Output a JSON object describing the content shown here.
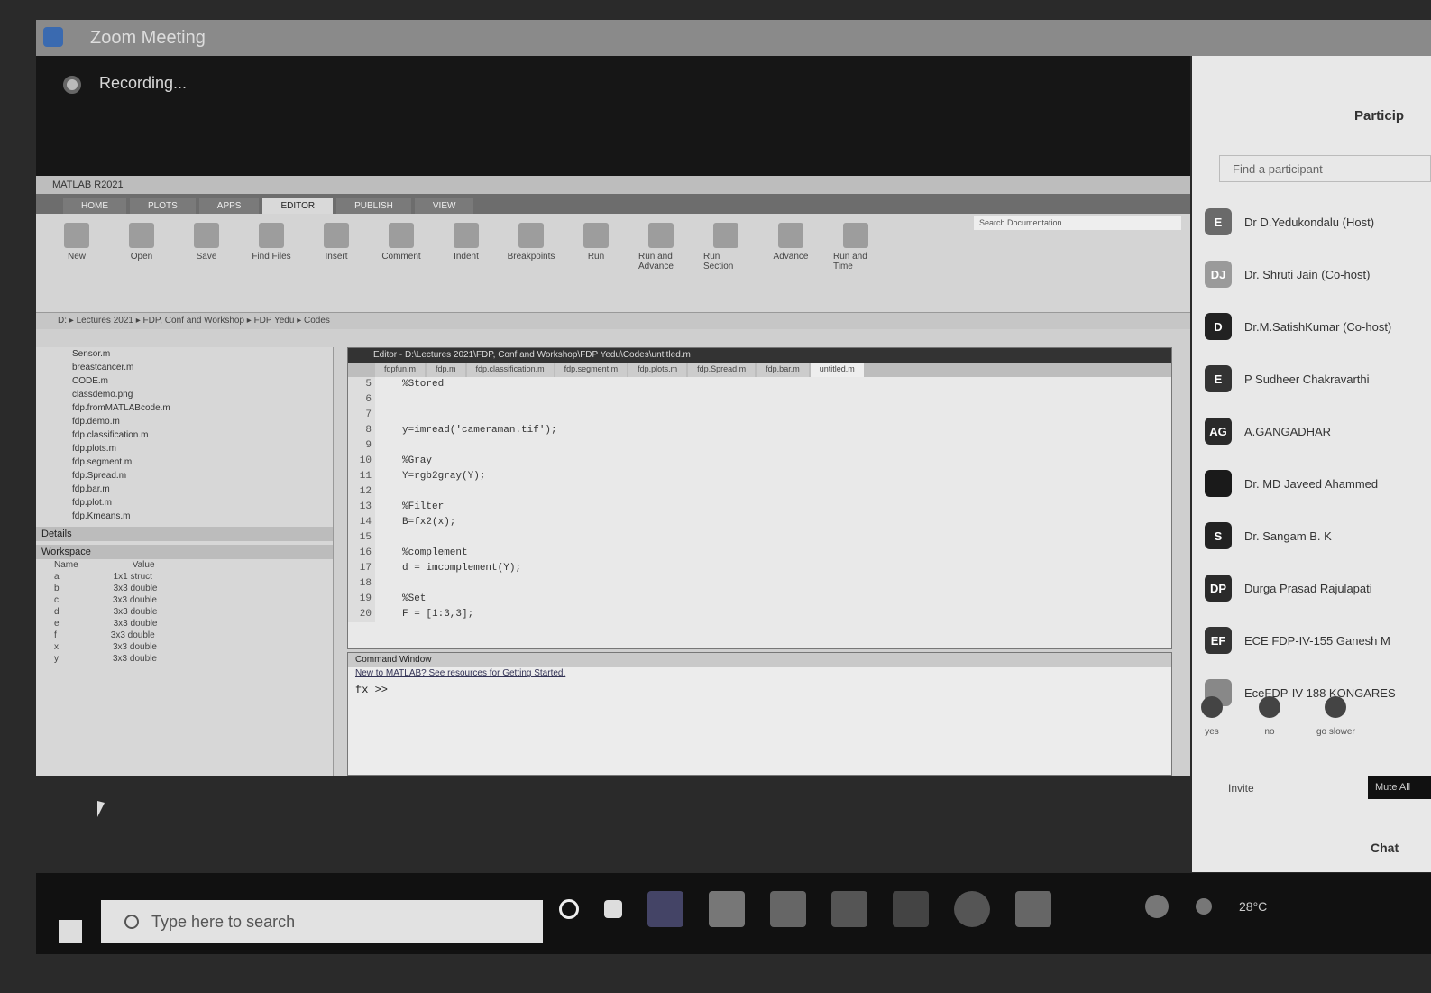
{
  "zoom": {
    "window_title": "Zoom Meeting",
    "recording_label": "Recording..."
  },
  "matlab": {
    "window_title": "MATLAB R2021",
    "tabs": [
      "HOME",
      "PLOTS",
      "APPS",
      "EDITOR",
      "PUBLISH",
      "VIEW"
    ],
    "search_placeholder": "Search Documentation",
    "ribbon": [
      {
        "label": "New"
      },
      {
        "label": "Open"
      },
      {
        "label": "Save"
      },
      {
        "label": "Find Files"
      },
      {
        "label": "Insert"
      },
      {
        "label": "Comment"
      },
      {
        "label": "Indent"
      },
      {
        "label": "Breakpoints"
      },
      {
        "label": "Run"
      },
      {
        "label": "Run and Advance"
      },
      {
        "label": "Run Section"
      },
      {
        "label": "Advance"
      },
      {
        "label": "Run and Time"
      }
    ],
    "path": "D: ▸ Lectures 2021 ▸ FDP, Conf and Workshop ▸ FDP Yedu ▸ Codes",
    "files": [
      "Sensor.m",
      "breastcancer.m",
      "CODE.m",
      "classdemo.png",
      "fdp.fromMATLABcode.m",
      "fdp.demo.m",
      "fdp.classification.m",
      "fdp.plots.m",
      "fdp.segment.m",
      "fdp.Spread.m",
      "fdp.bar.m",
      "fdp.plot.m",
      "fdp.Kmeans.m"
    ],
    "details_label": "Details",
    "workspace_label": "Workspace",
    "workspace_headers": [
      "Name",
      "Value"
    ],
    "workspace_rows": [
      {
        "name": "a",
        "value": "1x1 struct"
      },
      {
        "name": "b",
        "value": "3x3 double"
      },
      {
        "name": "c",
        "value": "3x3 double"
      },
      {
        "name": "d",
        "value": "3x3 double"
      },
      {
        "name": "e",
        "value": "3x3 double"
      },
      {
        "name": "f",
        "value": "3x3 double"
      },
      {
        "name": "x",
        "value": "3x3 double"
      },
      {
        "name": "y",
        "value": "3x3 double"
      }
    ],
    "editor": {
      "title": "Editor - D:\\Lectures 2021\\FDP, Conf and Workshop\\FDP Yedu\\Codes\\untitled.m",
      "tabs": [
        "fdpfun.m",
        "fdp.m",
        "fdp.classification.m",
        "fdp.segment.m",
        "fdp.plots.m",
        "fdp.Spread.m",
        "fdp.bar.m",
        "untitled.m"
      ],
      "line_numbers": [
        "5",
        "6",
        "7",
        "8",
        "9",
        "10",
        "11",
        "12",
        "13",
        "14",
        "15",
        "16",
        "17",
        "18",
        "19",
        "20"
      ],
      "code_lines": [
        "%Stored",
        "",
        "",
        "y=imread('cameraman.tif');",
        "",
        "%Gray",
        "Y=rgb2gray(Y);",
        "",
        "%Filter",
        "B=fx2(x);",
        "",
        "%complement",
        "d = imcomplement(Y);",
        "",
        "%Set",
        "F = [1:3,3];"
      ]
    },
    "command_window": {
      "title": "Command Window",
      "info": "New to MATLAB? See resources for Getting Started.",
      "prompt": "fx >>"
    }
  },
  "participants": {
    "header": "Particip",
    "search_placeholder": "Find a participant",
    "list": [
      {
        "initials": "E",
        "name": "Dr D.Yedukondalu (Host)",
        "color": "#6a6a6a"
      },
      {
        "initials": "DJ",
        "name": "Dr. Shruti Jain (Co-host)",
        "color": "#9a9a9a"
      },
      {
        "initials": "D",
        "name": "Dr.M.SatishKumar (Co-host)",
        "color": "#222222"
      },
      {
        "initials": "E",
        "name": "P Sudheer Chakravarthi",
        "color": "#333333"
      },
      {
        "initials": "AG",
        "name": "A.GANGADHAR",
        "color": "#2a2a2a"
      },
      {
        "initials": "",
        "name": "Dr. MD Javeed Ahammed",
        "color": "#1a1a1a"
      },
      {
        "initials": "S",
        "name": "Dr. Sangam B. K",
        "color": "#222222"
      },
      {
        "initials": "DP",
        "name": "Durga Prasad Rajulapati",
        "color": "#2a2a2a"
      },
      {
        "initials": "EF",
        "name": "ECE FDP-IV-155 Ganesh M",
        "color": "#333333"
      },
      {
        "initials": "",
        "name": "EceFDP-IV-188 KONGARES",
        "color": "#888888"
      }
    ],
    "actions": [
      "yes",
      "no",
      "go slower",
      "go"
    ],
    "invite_label": "Invite",
    "mute_label": "Mute All",
    "chat_label": "Chat"
  },
  "taskbar": {
    "search_placeholder": "Type here to search",
    "temperature": "28°C"
  }
}
